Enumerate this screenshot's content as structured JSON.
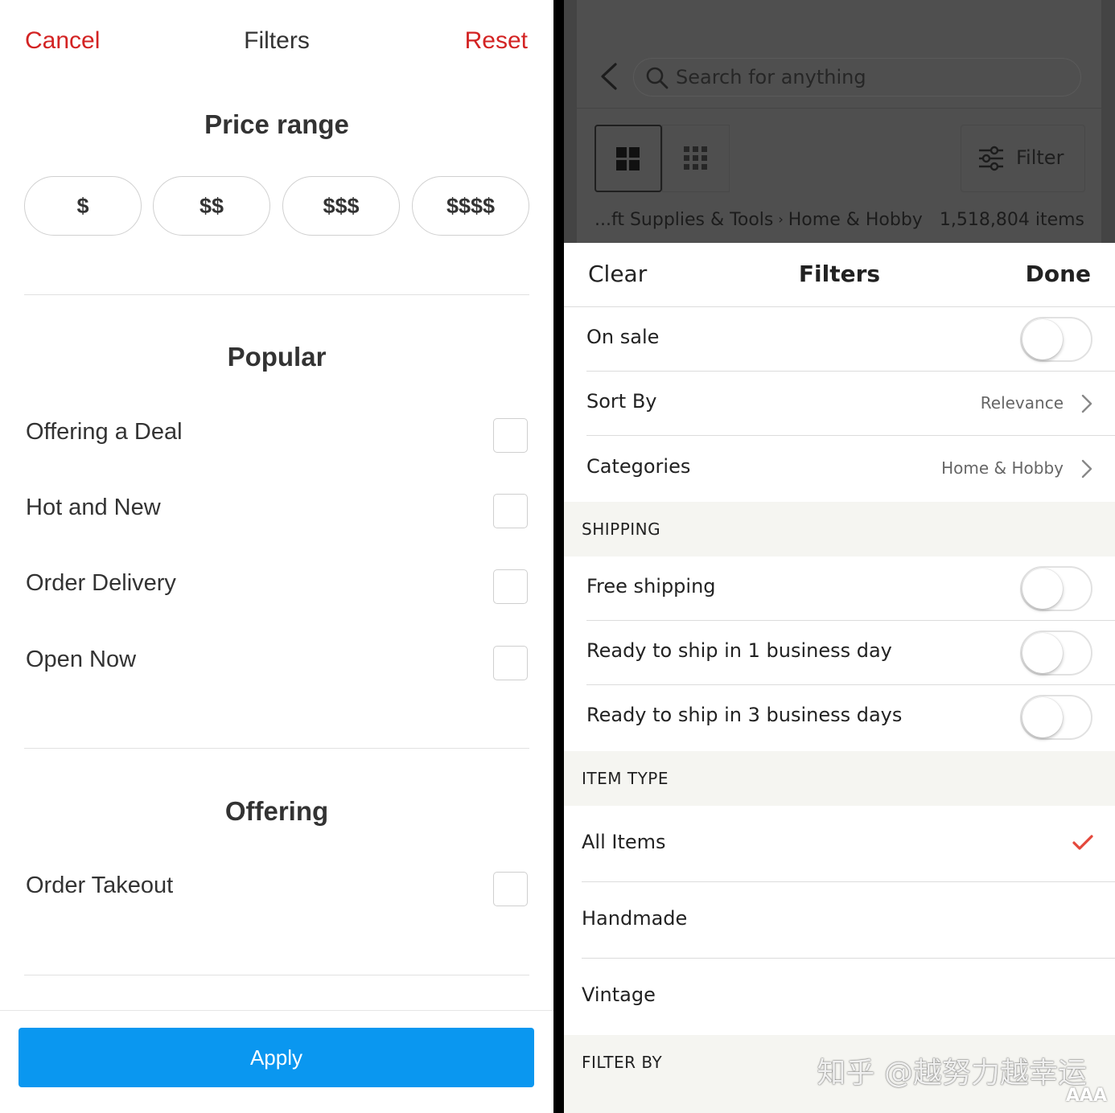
{
  "left": {
    "header": {
      "cancel": "Cancel",
      "title": "Filters",
      "reset": "Reset"
    },
    "price_range": {
      "title": "Price range",
      "options": [
        "$",
        "$$",
        "$$$",
        "$$$$"
      ]
    },
    "popular": {
      "title": "Popular",
      "items": [
        {
          "label": "Offering a Deal",
          "checked": false
        },
        {
          "label": "Hot and New",
          "checked": false
        },
        {
          "label": "Order Delivery",
          "checked": false
        },
        {
          "label": "Open Now",
          "checked": false
        }
      ]
    },
    "offering": {
      "title": "Offering",
      "items": [
        {
          "label": "Order Takeout",
          "checked": false
        }
      ]
    },
    "apply": "Apply",
    "colors": {
      "accent": "#d32323",
      "apply_button": "#0a97f0"
    }
  },
  "right": {
    "search": {
      "placeholder": "Search for anything"
    },
    "filter_button": "Filter",
    "breadcrumb": {
      "parent": "...ft Supplies & Tools",
      "current": "Home & Hobby"
    },
    "item_count": "1,518,804 items",
    "sheet": {
      "clear": "Clear",
      "title": "Filters",
      "done": "Done"
    },
    "rows": {
      "on_sale": {
        "label": "On sale",
        "on": false
      },
      "sort_by": {
        "label": "Sort By",
        "value": "Relevance"
      },
      "categories": {
        "label": "Categories",
        "value": "Home & Hobby"
      }
    },
    "shipping": {
      "title": "SHIPPING",
      "items": [
        {
          "label": "Free shipping",
          "on": false
        },
        {
          "label": "Ready to ship in 1 business day",
          "on": false
        },
        {
          "label": "Ready to ship in 3 business days",
          "on": false
        }
      ]
    },
    "item_type": {
      "title": "ITEM TYPE",
      "items": [
        {
          "label": "All Items",
          "selected": true
        },
        {
          "label": "Handmade",
          "selected": false
        },
        {
          "label": "Vintage",
          "selected": false
        }
      ]
    },
    "filter_by": {
      "title": "FILTER BY"
    },
    "colors": {
      "check": "#e4473b",
      "section_bg": "#f5f5f1"
    }
  },
  "watermark": {
    "text": "知乎 @越努力越幸运",
    "logo": "AAA"
  },
  "icons": [
    "back-arrow-icon",
    "search-icon",
    "grid-large-icon",
    "grid-small-icon",
    "sliders-icon",
    "chevron-right-icon",
    "checkmark-icon"
  ]
}
